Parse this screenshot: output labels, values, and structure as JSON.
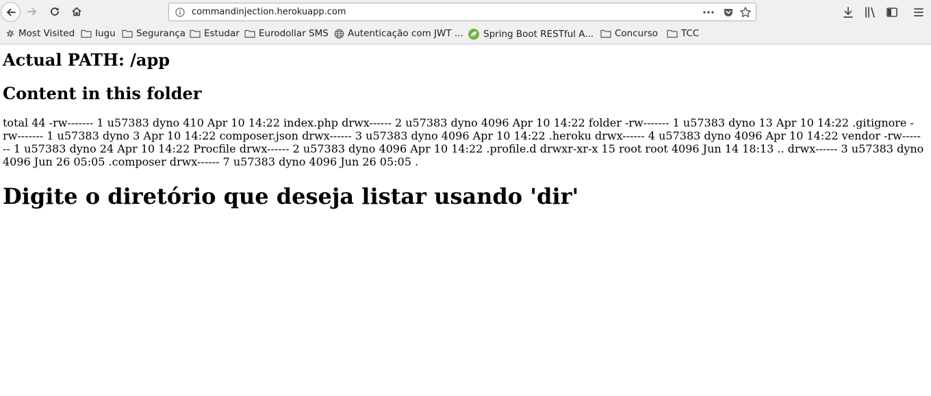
{
  "browser": {
    "url": "commandinjection.herokuapp.com",
    "bookmarks": [
      {
        "label": "Most Visited",
        "icon": "gear-icon"
      },
      {
        "label": "Iugu",
        "icon": "folder-icon"
      },
      {
        "label": "Segurança",
        "icon": "folder-icon"
      },
      {
        "label": "Estudar",
        "icon": "folder-icon"
      },
      {
        "label": "Eurodollar SMS",
        "icon": "folder-icon"
      },
      {
        "label": "Autenticação com JWT ...",
        "icon": "globe-icon"
      },
      {
        "label": "Spring Boot RESTful A...",
        "icon": "spring-leaf-icon"
      },
      {
        "label": "Concurso",
        "icon": "folder-icon"
      },
      {
        "label": "TCC",
        "icon": "folder-icon"
      }
    ]
  },
  "page": {
    "path_heading": "Actual PATH: /app",
    "content_heading": "Content in this folder",
    "listing": "total 44 -rw------- 1 u57383 dyno 410 Apr 10 14:22 index.php drwx------ 2 u57383 dyno 4096 Apr 10 14:22 folder -rw------- 1 u57383 dyno 13 Apr 10 14:22 .gitignore -rw------- 1 u57383 dyno 3 Apr 10 14:22 composer.json drwx------ 3 u57383 dyno 4096 Apr 10 14:22 .heroku drwx------ 4 u57383 dyno 4096 Apr 10 14:22 vendor -rw------- 1 u57383 dyno 24 Apr 10 14:22 Procfile drwx------ 2 u57383 dyno 4096 Apr 10 14:22 .profile.d drwxr-xr-x 15 root root 4096 Jun 14 18:13 .. drwx------ 3 u57383 dyno 4096 Jun 26 05:05 .composer drwx------ 7 u57383 dyno 4096 Jun 26 05:05 .",
    "prompt_heading": "Digite o diretório que deseja listar usando 'dir'"
  }
}
